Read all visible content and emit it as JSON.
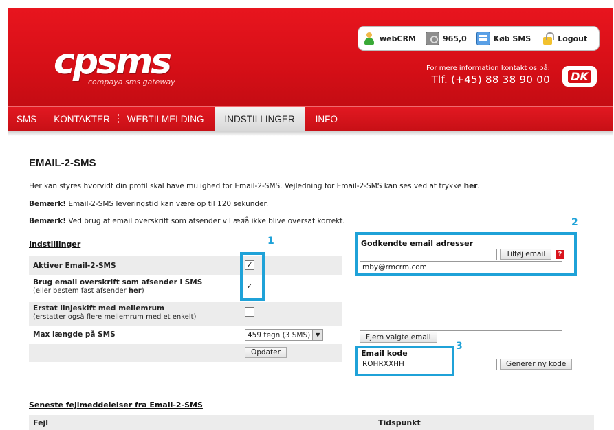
{
  "brand": {
    "logo_text": "cpsms",
    "tagline": "compaya sms gateway",
    "contact_line1": "For mere information kontakt os på:",
    "contact_line2": "Tlf. (+45) 88 38 90 00",
    "badge": "DK"
  },
  "toolbar": {
    "items": [
      {
        "label": "webCRM",
        "icon": "user-icon"
      },
      {
        "label": "965,0",
        "icon": "safe-icon"
      },
      {
        "label": "Køb SMS",
        "icon": "card-icon"
      },
      {
        "label": "Logout",
        "icon": "lock-icon"
      }
    ]
  },
  "nav": {
    "items": [
      "SMS",
      "KONTAKTER",
      "WEBTILMELDING",
      "INDSTILLINGER",
      "INFO"
    ],
    "active": "INDSTILLINGER"
  },
  "page": {
    "title": "EMAIL-2-SMS",
    "intro_text": "Her kan styres hvorvidt din profil skal have mulighed for Email-2-SMS. Vejledning for Email-2-SMS kan ses ved at trykke ",
    "intro_link": "her",
    "intro_end": ".",
    "note1_bold": "Bemærk!",
    "note1_text": " Email-2-SMS leveringstid kan være op til 120 sekunder.",
    "note2_bold": "Bemærk!",
    "note2_text": " Ved brug af email overskrift som afsender vil æøå ikke blive oversat korrekt."
  },
  "settings": {
    "heading": "Indstillinger",
    "rows": [
      {
        "label": "Aktiver Email-2-SMS",
        "checked": true
      },
      {
        "label": "Brug email overskrift som afsender i SMS",
        "sub_pre": "(eller bestem fast afsender ",
        "sub_link": "her",
        "sub_post": ")",
        "checked": true
      },
      {
        "label": "Erstat linjeskift med mellemrum",
        "sub": "(erstatter også flere mellemrum med et enkelt)",
        "checked": false
      },
      {
        "label": "Max længde på SMS",
        "select_value": "459 tegn (3 SMS)"
      }
    ],
    "update_button": "Opdater",
    "check_mark": "✓"
  },
  "emails": {
    "heading": "Godkendte email adresser",
    "input_value": "",
    "add_button": "Tilføj email",
    "help_label": "?",
    "list": [
      "mby@rmcrm.com"
    ],
    "remove_button": "Fjern valgte email"
  },
  "email_code": {
    "heading": "Email kode",
    "value": "ROHRXXHH",
    "generate_button": "Generer ny kode"
  },
  "errors": {
    "heading": "Seneste fejlmeddelelser fra Email-2-SMS",
    "col_error": "Fejl",
    "col_time": "Tidspunkt"
  },
  "annotations": [
    "1",
    "2",
    "3"
  ],
  "colors": {
    "brand_red": "#d60f17",
    "annotation_blue": "#1fa2d8",
    "row_shade": "#ececec"
  }
}
